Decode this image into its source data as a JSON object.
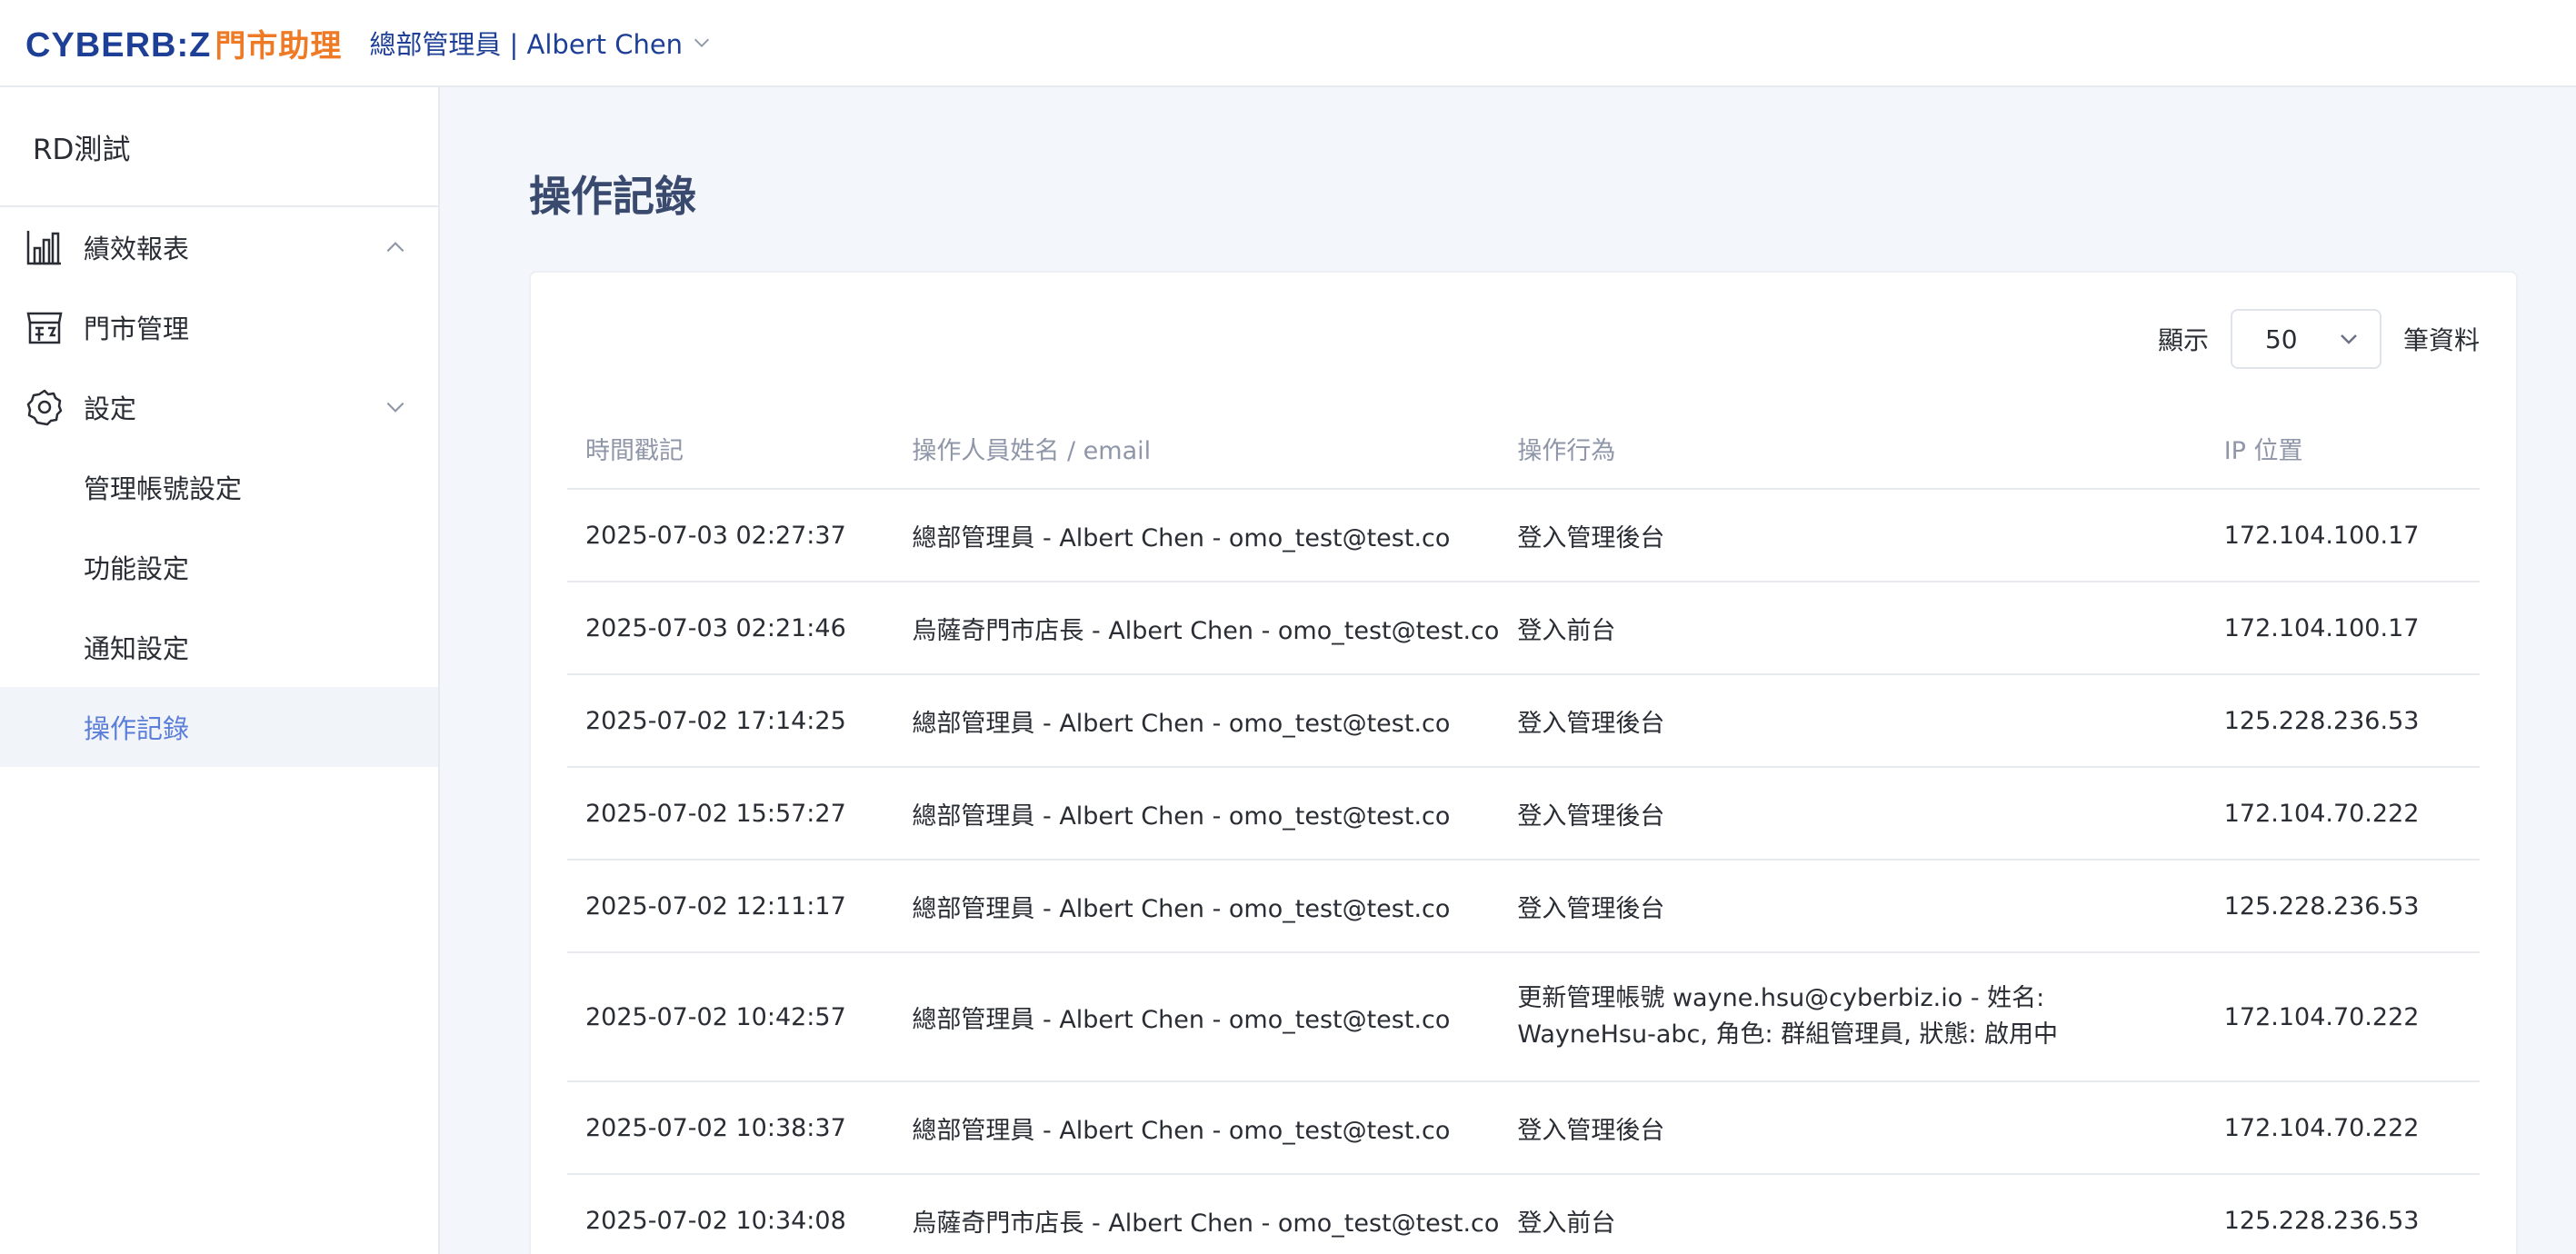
{
  "header": {
    "logo_brand": "CYBERB:Z",
    "logo_sub": "門市助理",
    "user_menu": "總部管理員 | Albert Chen"
  },
  "sidebar": {
    "store_name": "RD測試",
    "items": [
      {
        "label": "績效報表",
        "icon": "bar-chart-icon",
        "expanded": true
      },
      {
        "label": "門市管理",
        "icon": "store-icon"
      },
      {
        "label": "設定",
        "icon": "gear-icon",
        "expanded": false
      }
    ],
    "sub_items": [
      {
        "label": "管理帳號設定"
      },
      {
        "label": "功能設定"
      },
      {
        "label": "通知設定"
      },
      {
        "label": "操作記錄",
        "active": true
      }
    ]
  },
  "main": {
    "title": "操作記錄",
    "page_size": {
      "prefix": "顯示",
      "value": "50",
      "suffix": "筆資料"
    },
    "table": {
      "headers": [
        "時間戳記",
        "操作人員姓名 / email",
        "操作行為",
        "IP 位置"
      ],
      "rows": [
        {
          "time": "2025-07-03 02:27:37",
          "operator": "總部管理員 - Albert Chen - omo_test@test.co",
          "action": "登入管理後台",
          "ip": "172.104.100.17"
        },
        {
          "time": "2025-07-03 02:21:46",
          "operator": "烏薩奇門市店長 - Albert Chen - omo_test@test.co",
          "action": "登入前台",
          "ip": "172.104.100.17"
        },
        {
          "time": "2025-07-02 17:14:25",
          "operator": "總部管理員 - Albert Chen - omo_test@test.co",
          "action": "登入管理後台",
          "ip": "125.228.236.53"
        },
        {
          "time": "2025-07-02 15:57:27",
          "operator": "總部管理員 - Albert Chen - omo_test@test.co",
          "action": "登入管理後台",
          "ip": "172.104.70.222"
        },
        {
          "time": "2025-07-02 12:11:17",
          "operator": "總部管理員 - Albert Chen - omo_test@test.co",
          "action": "登入管理後台",
          "ip": "125.228.236.53"
        },
        {
          "time": "2025-07-02 10:42:57",
          "operator": "總部管理員 - Albert Chen - omo_test@test.co",
          "action": "更新管理帳號 wayne.hsu@cyberbiz.io - 姓名: WayneHsu-abc, 角色: 群組管理員, 狀態: 啟用中",
          "ip": "172.104.70.222"
        },
        {
          "time": "2025-07-02 10:38:37",
          "operator": "總部管理員 - Albert Chen - omo_test@test.co",
          "action": "登入管理後台",
          "ip": "172.104.70.222"
        },
        {
          "time": "2025-07-02 10:34:08",
          "operator": "烏薩奇門市店長 - Albert Chen - omo_test@test.co",
          "action": "登入前台",
          "ip": "125.228.236.53"
        }
      ]
    }
  },
  "colors": {
    "brand_blue": "#1e3f96",
    "brand_orange": "#ee7a26",
    "active_text": "#5b7ed9",
    "title": "#3a4a6e"
  }
}
